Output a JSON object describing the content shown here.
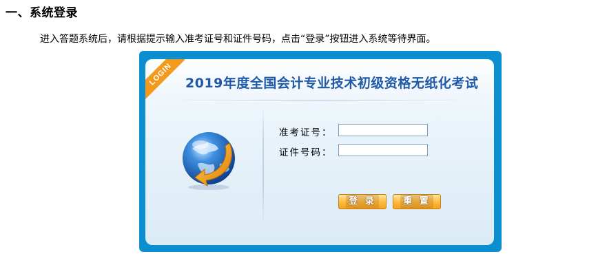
{
  "section": {
    "title": "一、系统登录",
    "intro": "进入答题系统后，请根据提示输入准考证号和证件号码，点击“登录”按钮进入系统等待界面。"
  },
  "login": {
    "ribbon": "LOGIN",
    "title": "2019年度全国会计专业技术初级资格无纸化考试",
    "fields": [
      {
        "label": "准考证号：",
        "value": ""
      },
      {
        "label": "证件号码：",
        "value": ""
      }
    ],
    "buttons": {
      "login": "登 录",
      "reset": "重 置"
    }
  },
  "colors": {
    "frame": "#0b8fd0",
    "title": "#1f5aa8",
    "ribbon": "#f39a1c",
    "button": "#f4a21f"
  },
  "icons": {
    "globe": "globe-arrow-icon"
  }
}
